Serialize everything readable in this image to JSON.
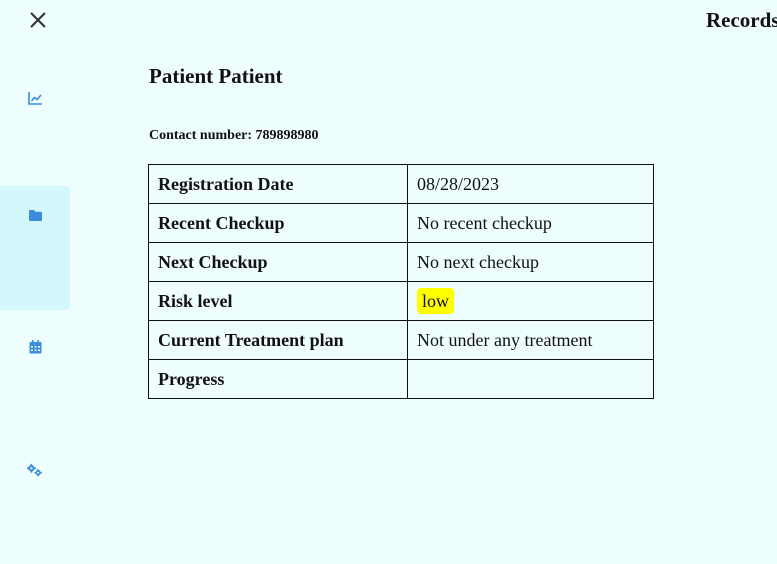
{
  "header": {
    "title": "Records"
  },
  "sidebar": {
    "items": [
      {
        "name": "chart",
        "icon": "chart-line-icon",
        "active": false
      },
      {
        "name": "records",
        "icon": "folder-icon",
        "active": true
      },
      {
        "name": "calendar",
        "icon": "calendar-icon",
        "active": false
      },
      {
        "name": "settings",
        "icon": "gears-icon",
        "active": false
      }
    ]
  },
  "patient": {
    "name": "Patient Patient",
    "contact": "Contact number: 789898980"
  },
  "table": {
    "rows": [
      {
        "label": "Registration Date",
        "value": "08/28/2023"
      },
      {
        "label": "Recent Checkup",
        "value": "No recent checkup"
      },
      {
        "label": "Next Checkup",
        "value": "No next checkup"
      },
      {
        "label": "Risk level",
        "value": "low"
      },
      {
        "label": "Current Treatment plan",
        "value": "Not under any treatment"
      },
      {
        "label": "Progress",
        "value": ""
      }
    ]
  },
  "colors": {
    "background": "#eefefe",
    "sidebar_active": "#d2f8fb",
    "icon": "#3a8ddc",
    "risk_low": "#ffff00"
  }
}
